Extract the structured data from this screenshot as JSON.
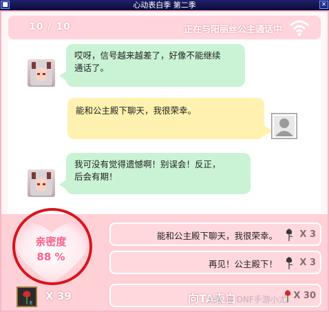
{
  "window": {
    "title": "心动表白季 第二季"
  },
  "header": {
    "counter": "10 / 10",
    "status": "正在与阳丽丝公主通话中",
    "wifi_icon": "wifi-icon"
  },
  "messages": [
    {
      "sender": "npc",
      "text_lines": [
        "哎呀，信号越来越差了，好像不能继续",
        "通话了。"
      ]
    },
    {
      "sender": "user",
      "text_lines": [
        "能和公主殿下聊天，我很荣幸。"
      ]
    },
    {
      "sender": "npc",
      "text_lines": [
        "我可没有觉得遗憾啊！别误会！反正，",
        "后会有期！"
      ]
    }
  ],
  "affinity": {
    "label": "亲密度",
    "value": "88 %"
  },
  "options": [
    {
      "text": "能和公主殿下聊天，我很荣幸。",
      "cost": "X 3"
    },
    {
      "text": "再见！公主殿下！",
      "cost": "X 3"
    }
  ],
  "confess": {
    "label": "向TA表白",
    "cost": "X 30"
  },
  "inventory": {
    "count": "X   39"
  },
  "watermark": "头条 @ DNF手游小尤",
  "colors": {
    "accent_pink": "#ff5f8a",
    "bubble_green": "#c9f3d4",
    "bubble_yellow": "#fff2b0",
    "annotation_red": "#d8141c"
  }
}
